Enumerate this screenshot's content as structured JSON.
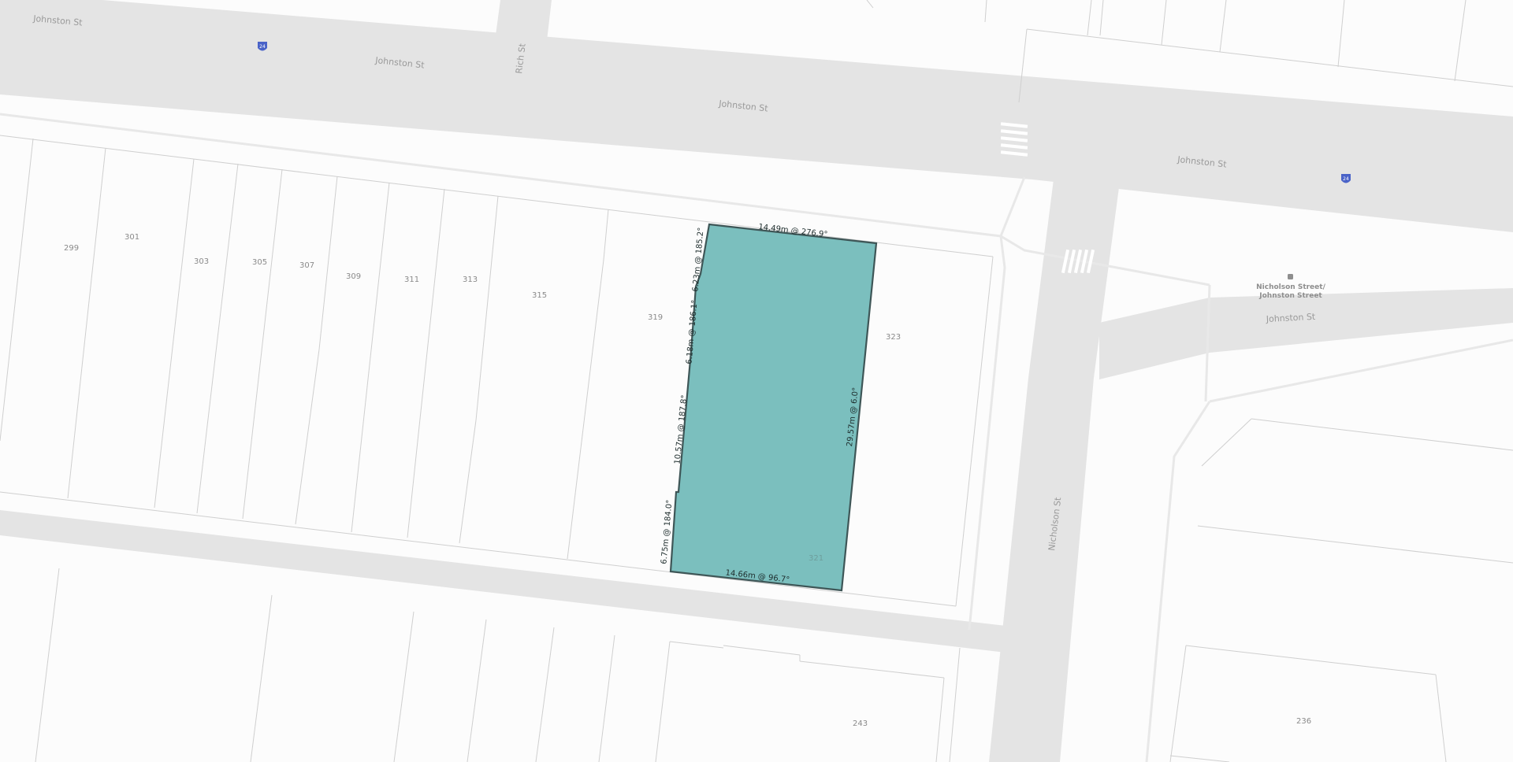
{
  "streets": {
    "johnston_1": "Johnston St",
    "johnston_2": "Johnston St",
    "johnston_3": "Johnston St",
    "johnston_4": "Johnston St",
    "johnston_5": "Johnston St",
    "rich": "Rich St",
    "nicholson": "Nicholson St"
  },
  "route_shields": [
    {
      "label": "24",
      "color": "#4a63c8"
    },
    {
      "label": "24",
      "color": "#4a63c8"
    }
  ],
  "tram_stop": {
    "line1": "Nicholson Street/",
    "line2": "Johnston Street",
    "icon": "tram-stop-icon"
  },
  "lots": {
    "l299": "299",
    "l301": "301",
    "l303": "303",
    "l305": "305",
    "l307": "307",
    "l309": "309",
    "l311": "311",
    "l313": "313",
    "l315": "315",
    "l319": "319",
    "l321": "321",
    "l323": "323",
    "l243": "243",
    "l236": "236"
  },
  "selected_parcel": {
    "fill_color": "#7bbfbe",
    "outline_color": "#3e5657",
    "dimensions": {
      "top": "14.49m @ 276.9°",
      "left_upper": "6.23m @ 185.2°",
      "left_mid": "6.18m @ 186.1°",
      "left_lower": "10.57m @ 187.8°",
      "left_bottom": "6.75m @ 184.0°",
      "right": "29.57m @ 6.0°",
      "bottom": "14.66m @ 96.7°"
    }
  }
}
